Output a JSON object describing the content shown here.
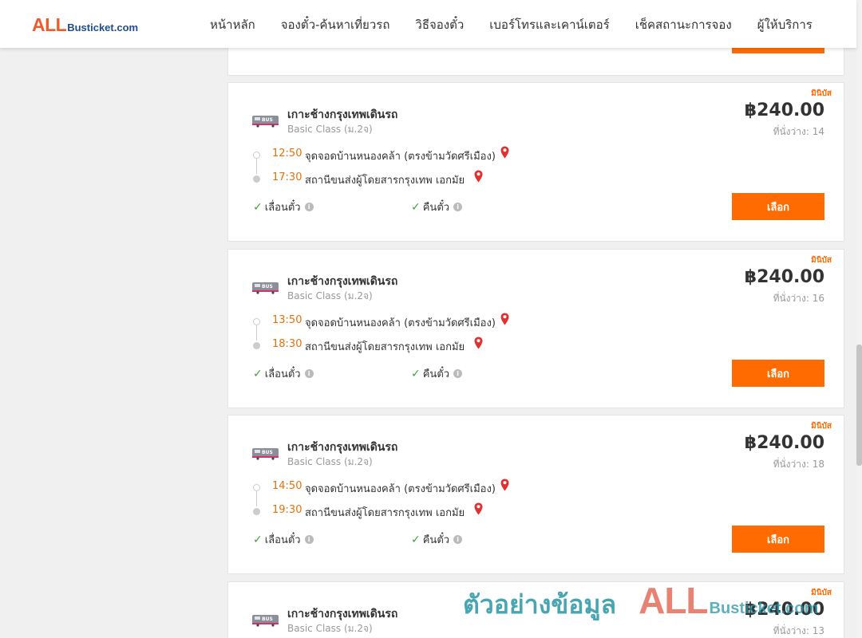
{
  "header": {
    "logo_all": "ALL",
    "logo_rest": "Busticket.com",
    "nav": [
      "หน้าหลัก",
      "จองตั๋ว-ค้นหาเที่ยวรถ",
      "วิธีจองตั๋ว",
      "เบอร์โทรและเคาน์เตอร์",
      "เช็คสถานะการจอง",
      "ผู้ให้บริการ"
    ]
  },
  "cards": [
    {
      "badge": "มินิบัส",
      "company": "เกาะช้างกรุงเทพเดินรถ",
      "class": "Basic Class (ม.2จ)",
      "price": "฿240.00",
      "seats": "ที่นั่งว่าง: 14",
      "depart_time": "12:50",
      "depart_stop": "จุดจอดบ้านหนองคล้า (ตรงข้ามวัดศรีเมือง)",
      "arrive_time": "17:30",
      "arrive_stop": "สถานีขนส่งผู้โดยสารกรุงเทพ เอกมัย",
      "feature_1": "เลื่อนตั๋ว",
      "feature_2": "คืนตั๋ว",
      "select_label": "เลือก"
    },
    {
      "badge": "มินิบัส",
      "company": "เกาะช้างกรุงเทพเดินรถ",
      "class": "Basic Class (ม.2จ)",
      "price": "฿240.00",
      "seats": "ที่นั่งว่าง: 16",
      "depart_time": "13:50",
      "depart_stop": "จุดจอดบ้านหนองคล้า (ตรงข้ามวัดศรีเมือง)",
      "arrive_time": "18:30",
      "arrive_stop": "สถานีขนส่งผู้โดยสารกรุงเทพ เอกมัย",
      "feature_1": "เลื่อนตั๋ว",
      "feature_2": "คืนตั๋ว",
      "select_label": "เลือก"
    },
    {
      "badge": "มินิบัส",
      "company": "เกาะช้างกรุงเทพเดินรถ",
      "class": "Basic Class (ม.2จ)",
      "price": "฿240.00",
      "seats": "ที่นั่งว่าง: 18",
      "depart_time": "14:50",
      "depart_stop": "จุดจอดบ้านหนองคล้า (ตรงข้ามวัดศรีเมือง)",
      "arrive_time": "19:30",
      "arrive_stop": "สถานีขนส่งผู้โดยสารกรุงเทพ เอกมัย",
      "feature_1": "เลื่อนตั๋ว",
      "feature_2": "คืนตั๋ว",
      "select_label": "เลือก"
    },
    {
      "badge": "มินิบัส",
      "company": "เกาะช้างกรุงเทพเดินรถ",
      "class": "Basic Class (ม.2จ)",
      "price": "฿240.00",
      "seats": "ที่นั่งว่าง: 13"
    }
  ],
  "watermark": {
    "thai": "ตัวอย่างข้อมูล",
    "all": "ALL",
    "rest": "Busticket.com"
  },
  "colors": {
    "accent": "#ff6b00",
    "time": "#e8700a",
    "check": "#3aa53a",
    "pin": "#e03030"
  }
}
